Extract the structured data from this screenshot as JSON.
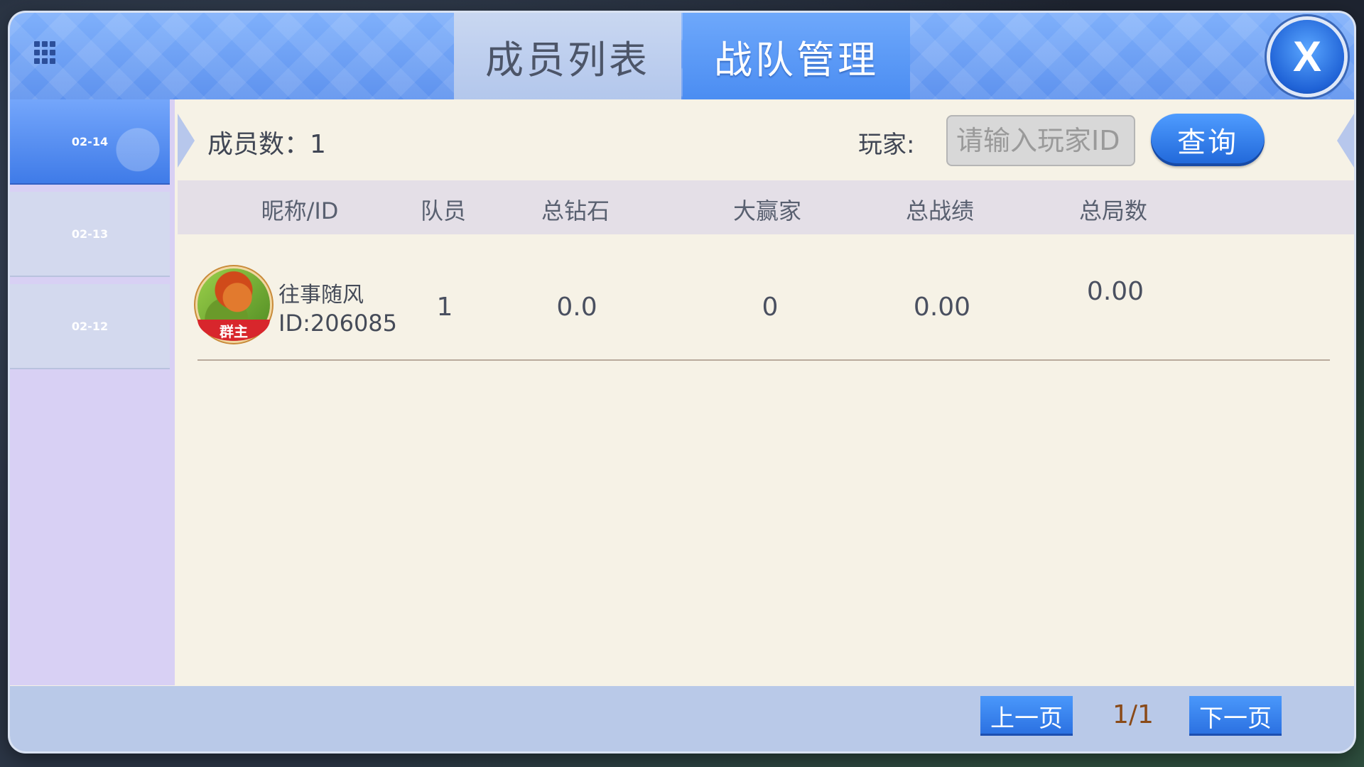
{
  "tabs": {
    "members_label": "成员列表",
    "team_label": "战队管理",
    "active": "team_label"
  },
  "close_glyph": "X",
  "sidebar": {
    "dates": [
      {
        "label": "02-14",
        "active": true
      },
      {
        "label": "02-13",
        "active": false
      },
      {
        "label": "02-12",
        "active": false
      }
    ]
  },
  "info": {
    "member_count_text": "成员数：1",
    "player_label": "玩家:",
    "search_placeholder": "请输入玩家ID",
    "query_label": "查询"
  },
  "table": {
    "headers": [
      "昵称/ID",
      "队员",
      "总钻石",
      "大赢家",
      "总战绩",
      "总局数"
    ],
    "rows": [
      {
        "nickname": "往事随风",
        "id": "ID:206085",
        "badge": "群主",
        "members": "1",
        "diamonds": "0.0",
        "big_winner": "0",
        "total_score": "0.00",
        "total_rounds": "0.00"
      }
    ]
  },
  "pagination": {
    "prev_label": "上一页",
    "indicator": "1/1",
    "next_label": "下一页"
  },
  "colors": {
    "accent_blue": "#4b8df2",
    "panel_bg": "#f6f2e6",
    "sidebar_bg": "#d8d0f4",
    "badge_red": "#d8262c"
  }
}
